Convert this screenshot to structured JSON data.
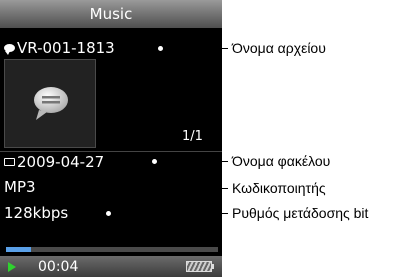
{
  "screen": {
    "title": "Music",
    "file_name": "VR-001-1813",
    "page_counter": "1/1",
    "folder_name": "2009-04-27",
    "codec": "MP3",
    "bitrate": "128kbps",
    "elapsed_time": "00:04",
    "progress_fraction": 0.12
  },
  "callouts": {
    "file_name_label": "Όνομα αρχείου",
    "folder_name_label": "Όνομα φακέλου",
    "codec_label": "Κωδικοποιητής",
    "bitrate_label": "Ρυθμός μετάδοσης bit"
  },
  "icons": {
    "voice_recording": "speech-bubble-icon",
    "folder": "folder-icon",
    "play": "play-icon",
    "battery": "battery-icon"
  },
  "colors": {
    "progress": "#5aa0e8",
    "play": "#2fd22f"
  }
}
